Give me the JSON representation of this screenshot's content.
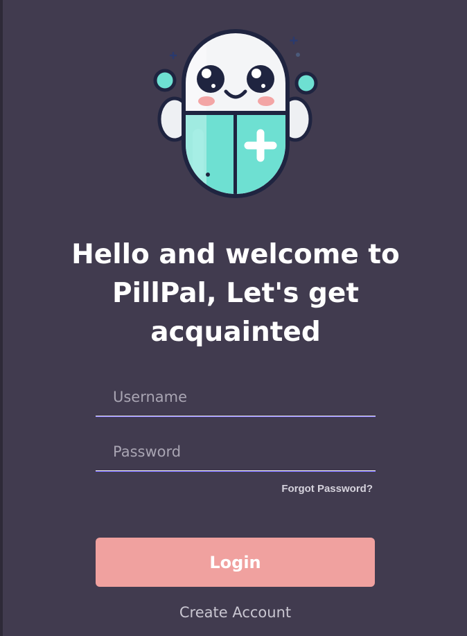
{
  "brand": {
    "logo_icon": "pill-mascot-icon",
    "app_name": "PillPal"
  },
  "welcome": {
    "heading": "Hello and welcome to PillPal, Let's get acquainted"
  },
  "login_form": {
    "username_placeholder": "Username",
    "username_value": "",
    "password_placeholder": "Password",
    "password_value": "",
    "forgot_password_label": "Forgot Password?",
    "login_label": "Login",
    "create_account_label": "Create Account"
  },
  "colors": {
    "background": "#413b4f",
    "accent_button": "#f0a19f",
    "mascot_mint": "#6ee0d2",
    "mascot_outline": "#1f2440",
    "text_primary": "#ffffff"
  }
}
